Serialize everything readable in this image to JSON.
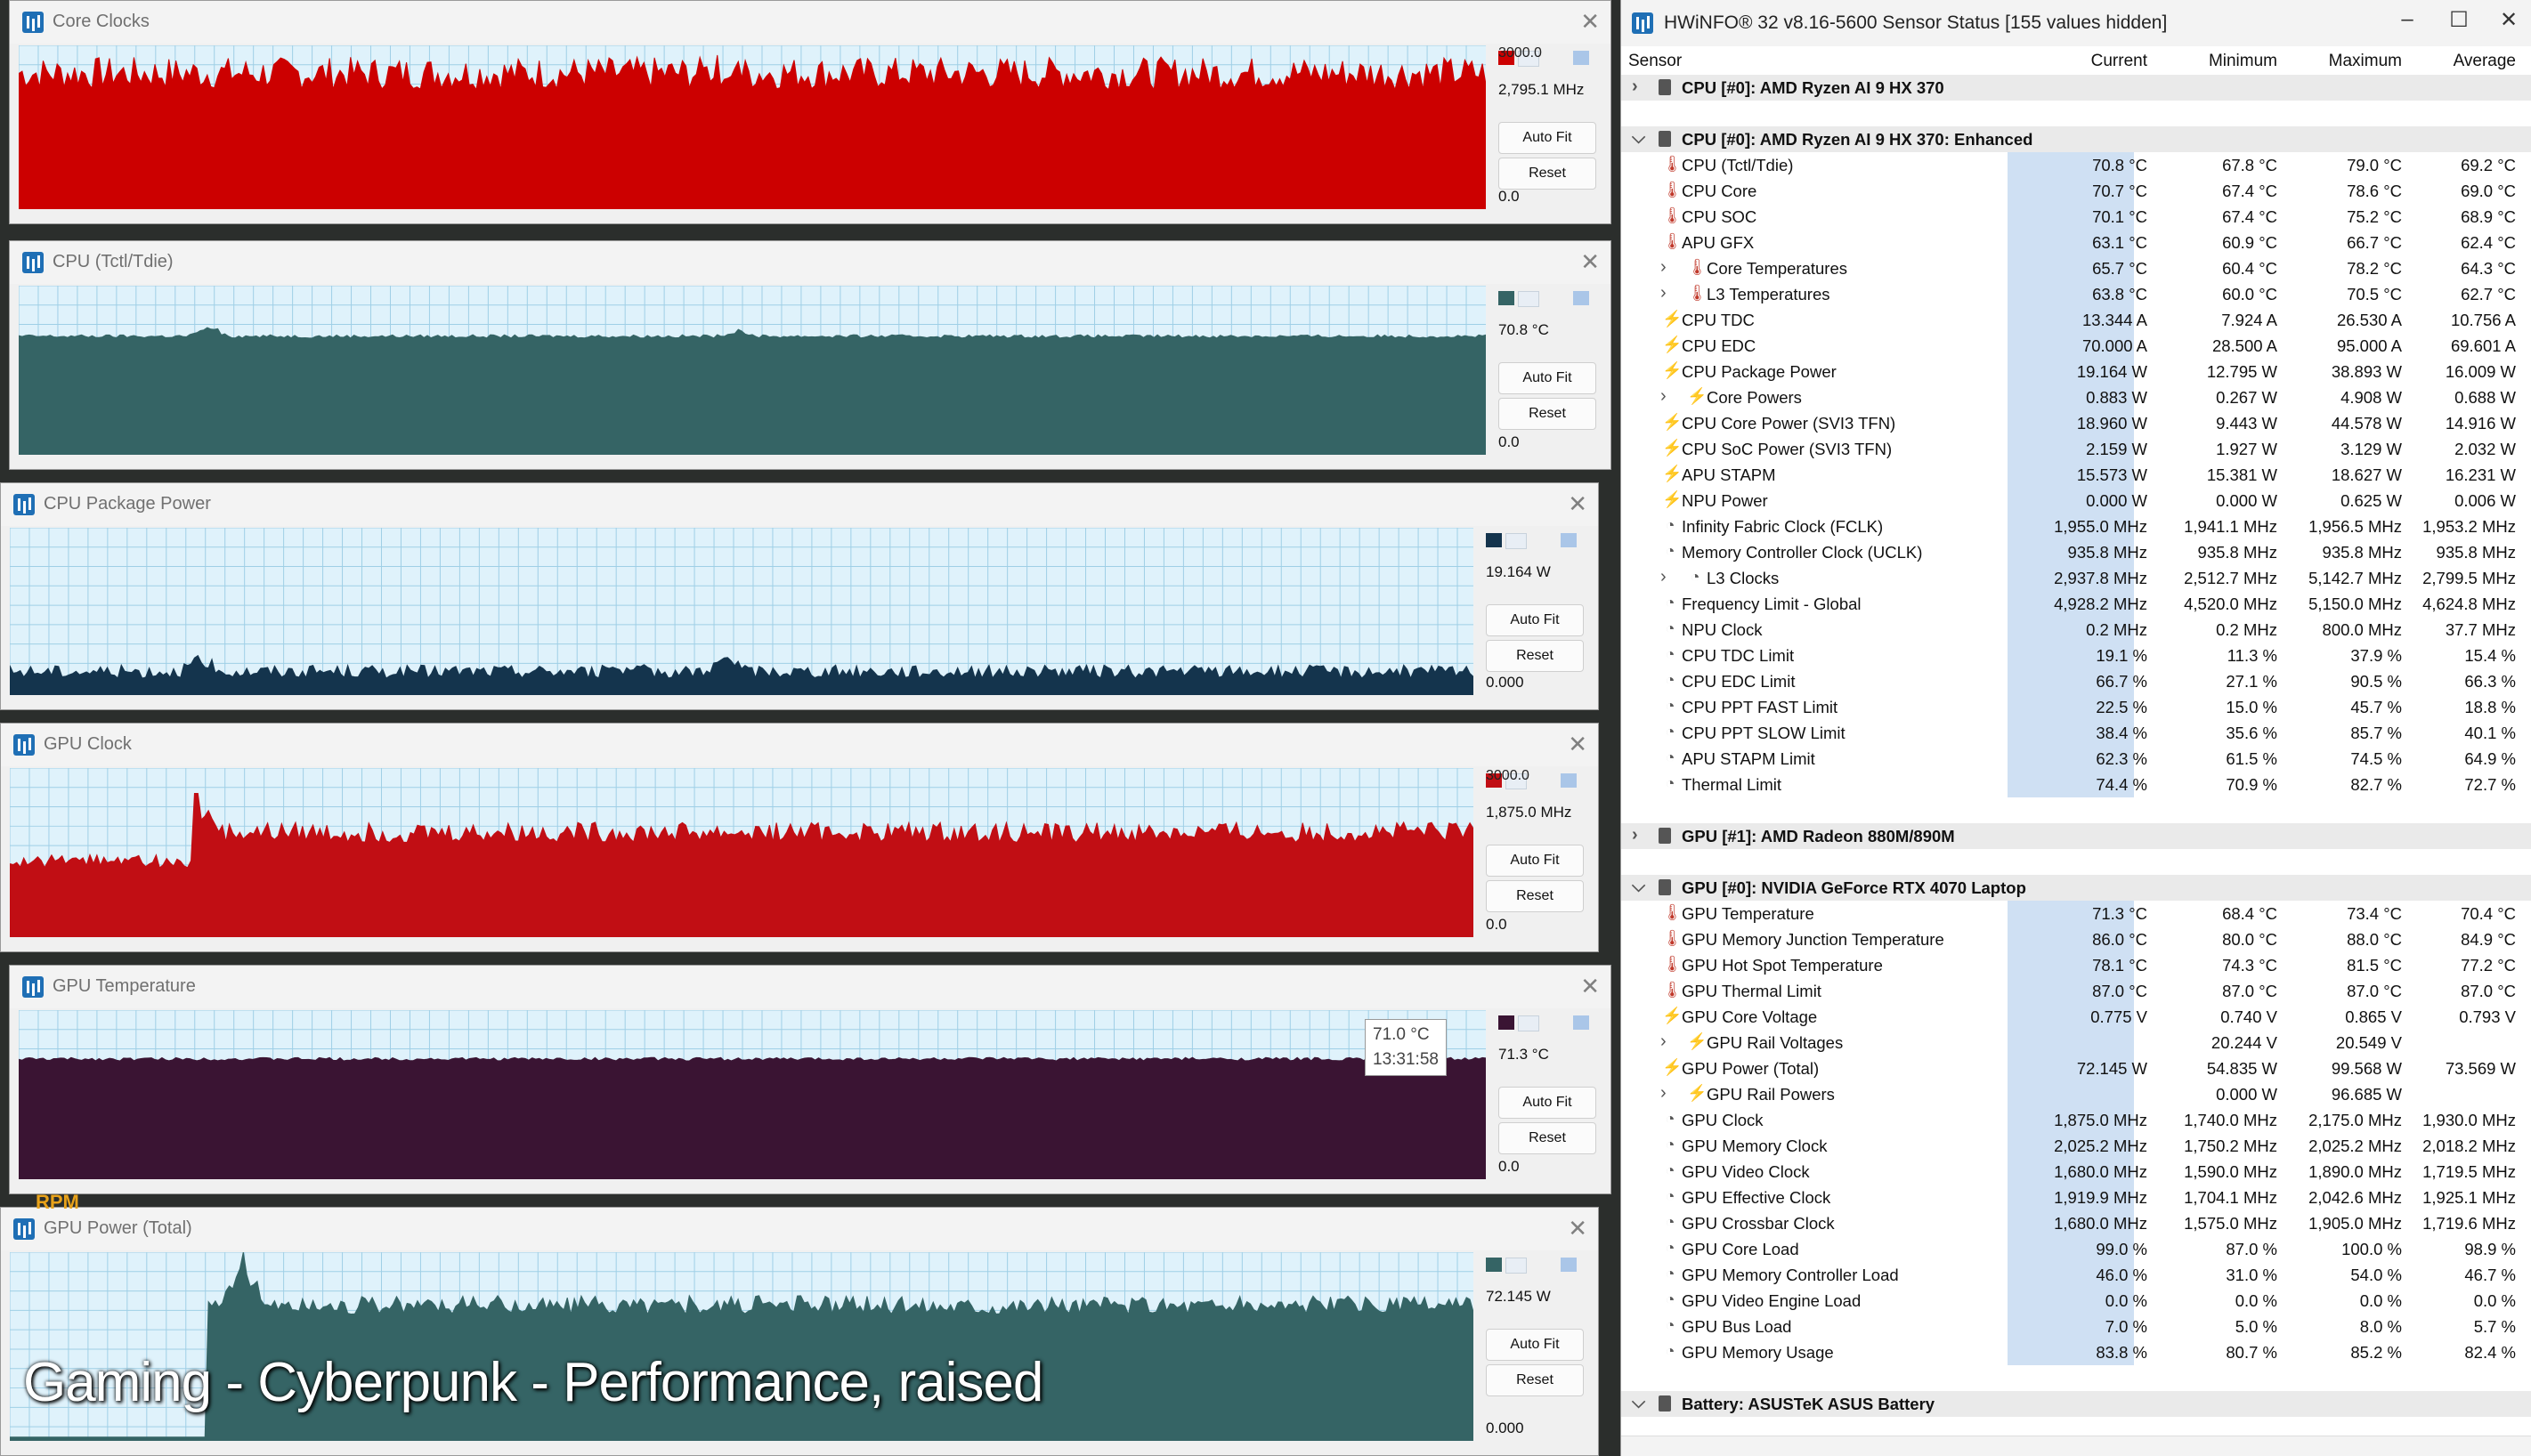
{
  "overlay": {
    "caption": "Gaming - Cyberpunk - Performance, raised",
    "hud": "RPM"
  },
  "graphs": [
    {
      "title": "Core Clocks",
      "top_value": "3000.0",
      "current": "2,795.1 MHz",
      "bottom_value": "0.0",
      "auto_fit": "Auto Fit",
      "reset": "Reset",
      "color": "#cc0000",
      "level": 0.83,
      "noise": 0.1,
      "spikes": [
        [
          0.48,
          0.1
        ]
      ]
    },
    {
      "title": "CPU (Tctl/Tdie)",
      "top_value": "",
      "current": "70.8 °C",
      "bottom_value": "0.0",
      "auto_fit": "Auto Fit",
      "reset": "Reset",
      "color": "#356465",
      "level": 0.7,
      "noise": 0.01,
      "spikes": [
        [
          0.13,
          0.2
        ],
        [
          0.49,
          0.12
        ]
      ]
    },
    {
      "title": "CPU Package Power",
      "top_value": "",
      "current": "19.164 W",
      "bottom_value": "0.000",
      "auto_fit": "Auto Fit",
      "reset": "Reset",
      "color": "#14344d",
      "level": 0.14,
      "noise": 0.04,
      "spikes": [
        [
          0.13,
          0.25
        ],
        [
          0.49,
          0.3
        ],
        [
          0.42,
          0.12
        ]
      ]
    },
    {
      "title": "GPU Clock",
      "top_value": "3000.0",
      "current": "1,875.0 MHz",
      "bottom_value": "0.0",
      "auto_fit": "Auto Fit",
      "reset": "Reset",
      "color": "#c10e14",
      "level": 0.62,
      "noise": 0.06,
      "spikes": [
        [
          0.13,
          0.8
        ]
      ]
    },
    {
      "title": "GPU Temperature",
      "top_value": "",
      "current": "71.3 °C",
      "bottom_value": "0.0",
      "auto_fit": "Auto Fit",
      "reset": "Reset",
      "color": "#3a1433",
      "level": 0.71,
      "noise": 0.01,
      "spikes": []
    },
    {
      "title": "GPU Power (Total)",
      "top_value": "",
      "current": "72.145 W",
      "bottom_value": "0.000",
      "auto_fit": "Auto Fit",
      "reset": "Reset",
      "color": "#356465",
      "level": 0.72,
      "noise": 0.05,
      "spikes": [
        [
          0.16,
          0.98
        ]
      ]
    }
  ],
  "tooltip": {
    "value": "71.0 °C",
    "time": "13:31:58"
  },
  "sensor_window": {
    "title": "HWiNFO® 32 v8.16-5600 Sensor Status [155 values hidden]",
    "columns": {
      "sensor": "Sensor",
      "current": "Current",
      "minimum": "Minimum",
      "maximum": "Maximum",
      "average": "Average"
    },
    "rows": [
      {
        "type": "group",
        "name": "CPU [#0]: AMD Ryzen AI 9 HX 370",
        "expanded": false
      },
      {
        "type": "spacer"
      },
      {
        "type": "group",
        "name": "CPU [#0]: AMD Ryzen AI 9 HX 370: Enhanced",
        "expanded": true
      },
      {
        "name": "CPU (Tctl/Tdie)",
        "icon": "temp",
        "cur": "70.8 °C",
        "min": "67.8 °C",
        "max": "79.0 °C",
        "avg": "69.2 °C"
      },
      {
        "name": "CPU Core",
        "icon": "temp",
        "cur": "70.7 °C",
        "min": "67.4 °C",
        "max": "78.6 °C",
        "avg": "69.0 °C"
      },
      {
        "name": "CPU SOC",
        "icon": "temp",
        "cur": "70.1 °C",
        "min": "67.4 °C",
        "max": "75.2 °C",
        "avg": "68.9 °C"
      },
      {
        "name": "APU GFX",
        "icon": "temp",
        "cur": "63.1 °C",
        "min": "60.9 °C",
        "max": "66.7 °C",
        "avg": "62.4 °C"
      },
      {
        "name": "Core Temperatures",
        "icon": "temp",
        "sub": true,
        "cur": "65.7 °C",
        "min": "60.4 °C",
        "max": "78.2 °C",
        "avg": "64.3 °C"
      },
      {
        "name": "L3 Temperatures",
        "icon": "temp",
        "sub": true,
        "cur": "63.8 °C",
        "min": "60.0 °C",
        "max": "70.5 °C",
        "avg": "62.7 °C"
      },
      {
        "name": "CPU TDC",
        "icon": "volt",
        "cur": "13.344 A",
        "min": "7.924 A",
        "max": "26.530 A",
        "avg": "10.756 A"
      },
      {
        "name": "CPU EDC",
        "icon": "volt",
        "cur": "70.000 A",
        "min": "28.500 A",
        "max": "95.000 A",
        "avg": "69.601 A"
      },
      {
        "name": "CPU Package Power",
        "icon": "volt",
        "cur": "19.164 W",
        "min": "12.795 W",
        "max": "38.893 W",
        "avg": "16.009 W"
      },
      {
        "name": "Core Powers",
        "icon": "volt",
        "sub": true,
        "cur": "0.883 W",
        "min": "0.267 W",
        "max": "4.908 W",
        "avg": "0.688 W"
      },
      {
        "name": "CPU Core Power (SVI3 TFN)",
        "icon": "volt",
        "cur": "18.960 W",
        "min": "9.443 W",
        "max": "44.578 W",
        "avg": "14.916 W"
      },
      {
        "name": "CPU SoC Power (SVI3 TFN)",
        "icon": "volt",
        "cur": "2.159 W",
        "min": "1.927 W",
        "max": "3.129 W",
        "avg": "2.032 W"
      },
      {
        "name": "APU STAPM",
        "icon": "volt",
        "cur": "15.573 W",
        "min": "15.381 W",
        "max": "18.627 W",
        "avg": "16.231 W"
      },
      {
        "name": "NPU Power",
        "icon": "volt",
        "cur": "0.000 W",
        "min": "0.000 W",
        "max": "0.625 W",
        "avg": "0.006 W"
      },
      {
        "name": "Infinity Fabric Clock (FCLK)",
        "icon": "clk",
        "cur": "1,955.0 MHz",
        "min": "1,941.1 MHz",
        "max": "1,956.5 MHz",
        "avg": "1,953.2 MHz"
      },
      {
        "name": "Memory Controller Clock (UCLK)",
        "icon": "clk",
        "cur": "935.8 MHz",
        "min": "935.8 MHz",
        "max": "935.8 MHz",
        "avg": "935.8 MHz"
      },
      {
        "name": "L3 Clocks",
        "icon": "clk",
        "sub": true,
        "cur": "2,937.8 MHz",
        "min": "2,512.7 MHz",
        "max": "5,142.7 MHz",
        "avg": "2,799.5 MHz"
      },
      {
        "name": "Frequency Limit - Global",
        "icon": "clk",
        "cur": "4,928.2 MHz",
        "min": "4,520.0 MHz",
        "max": "5,150.0 MHz",
        "avg": "4,624.8 MHz"
      },
      {
        "name": "NPU Clock",
        "icon": "clk",
        "cur": "0.2 MHz",
        "min": "0.2 MHz",
        "max": "800.0 MHz",
        "avg": "37.7 MHz"
      },
      {
        "name": "CPU TDC Limit",
        "icon": "clk",
        "cur": "19.1 %",
        "min": "11.3 %",
        "max": "37.9 %",
        "avg": "15.4 %"
      },
      {
        "name": "CPU EDC Limit",
        "icon": "clk",
        "cur": "66.7 %",
        "min": "27.1 %",
        "max": "90.5 %",
        "avg": "66.3 %"
      },
      {
        "name": "CPU PPT FAST Limit",
        "icon": "clk",
        "cur": "22.5 %",
        "min": "15.0 %",
        "max": "45.7 %",
        "avg": "18.8 %"
      },
      {
        "name": "CPU PPT SLOW Limit",
        "icon": "clk",
        "cur": "38.4 %",
        "min": "35.6 %",
        "max": "85.7 %",
        "avg": "40.1 %"
      },
      {
        "name": "APU STAPM Limit",
        "icon": "clk",
        "cur": "62.3 %",
        "min": "61.5 %",
        "max": "74.5 %",
        "avg": "64.9 %"
      },
      {
        "name": "Thermal Limit",
        "icon": "clk",
        "cur": "74.4 %",
        "min": "70.9 %",
        "max": "82.7 %",
        "avg": "72.7 %"
      },
      {
        "type": "spacer"
      },
      {
        "type": "group",
        "name": "GPU [#1]: AMD Radeon 880M/890M",
        "expanded": false
      },
      {
        "type": "spacer"
      },
      {
        "type": "group",
        "name": "GPU [#0]: NVIDIA GeForce RTX 4070 Laptop",
        "expanded": true
      },
      {
        "name": "GPU Temperature",
        "icon": "temp",
        "cur": "71.3 °C",
        "min": "68.4 °C",
        "max": "73.4 °C",
        "avg": "70.4 °C"
      },
      {
        "name": "GPU Memory Junction Temperature",
        "icon": "temp",
        "cur": "86.0 °C",
        "min": "80.0 °C",
        "max": "88.0 °C",
        "avg": "84.9 °C"
      },
      {
        "name": "GPU Hot Spot Temperature",
        "icon": "temp",
        "cur": "78.1 °C",
        "min": "74.3 °C",
        "max": "81.5 °C",
        "avg": "77.2 °C"
      },
      {
        "name": "GPU Thermal Limit",
        "icon": "temp",
        "cur": "87.0 °C",
        "min": "87.0 °C",
        "max": "87.0 °C",
        "avg": "87.0 °C"
      },
      {
        "name": "GPU Core Voltage",
        "icon": "volt",
        "cur": "0.775 V",
        "min": "0.740 V",
        "max": "0.865 V",
        "avg": "0.793 V"
      },
      {
        "name": "GPU Rail Voltages",
        "icon": "volt",
        "sub": true,
        "cur": "",
        "min": "20.244 V",
        "max": "20.549 V",
        "avg": ""
      },
      {
        "name": "GPU Power (Total)",
        "icon": "volt",
        "cur": "72.145 W",
        "min": "54.835 W",
        "max": "99.568 W",
        "avg": "73.569 W"
      },
      {
        "name": "GPU Rail Powers",
        "icon": "volt",
        "sub": true,
        "cur": "",
        "min": "0.000 W",
        "max": "96.685 W",
        "avg": ""
      },
      {
        "name": "GPU Clock",
        "icon": "clk",
        "cur": "1,875.0 MHz",
        "min": "1,740.0 MHz",
        "max": "2,175.0 MHz",
        "avg": "1,930.0 MHz"
      },
      {
        "name": "GPU Memory Clock",
        "icon": "clk",
        "cur": "2,025.2 MHz",
        "min": "1,750.2 MHz",
        "max": "2,025.2 MHz",
        "avg": "2,018.2 MHz"
      },
      {
        "name": "GPU Video Clock",
        "icon": "clk",
        "cur": "1,680.0 MHz",
        "min": "1,590.0 MHz",
        "max": "1,890.0 MHz",
        "avg": "1,719.5 MHz"
      },
      {
        "name": "GPU Effective Clock",
        "icon": "clk",
        "cur": "1,919.9 MHz",
        "min": "1,704.1 MHz",
        "max": "2,042.6 MHz",
        "avg": "1,925.1 MHz"
      },
      {
        "name": "GPU Crossbar Clock",
        "icon": "clk",
        "cur": "1,680.0 MHz",
        "min": "1,575.0 MHz",
        "max": "1,905.0 MHz",
        "avg": "1,719.6 MHz"
      },
      {
        "name": "GPU Core Load",
        "icon": "clk",
        "cur": "99.0 %",
        "min": "87.0 %",
        "max": "100.0 %",
        "avg": "98.9 %"
      },
      {
        "name": "GPU Memory Controller Load",
        "icon": "clk",
        "cur": "46.0 %",
        "min": "31.0 %",
        "max": "54.0 %",
        "avg": "46.7 %"
      },
      {
        "name": "GPU Video Engine Load",
        "icon": "clk",
        "cur": "0.0 %",
        "min": "0.0 %",
        "max": "0.0 %",
        "avg": "0.0 %"
      },
      {
        "name": "GPU Bus Load",
        "icon": "clk",
        "cur": "7.0 %",
        "min": "5.0 %",
        "max": "8.0 %",
        "avg": "5.7 %"
      },
      {
        "name": "GPU Memory Usage",
        "icon": "clk",
        "cur": "83.8 %",
        "min": "80.7 %",
        "max": "85.2 %",
        "avg": "82.4 %"
      },
      {
        "type": "spacer"
      },
      {
        "type": "group",
        "name": "Battery: ASUSTeK ASUS Battery",
        "expanded": true
      }
    ]
  }
}
